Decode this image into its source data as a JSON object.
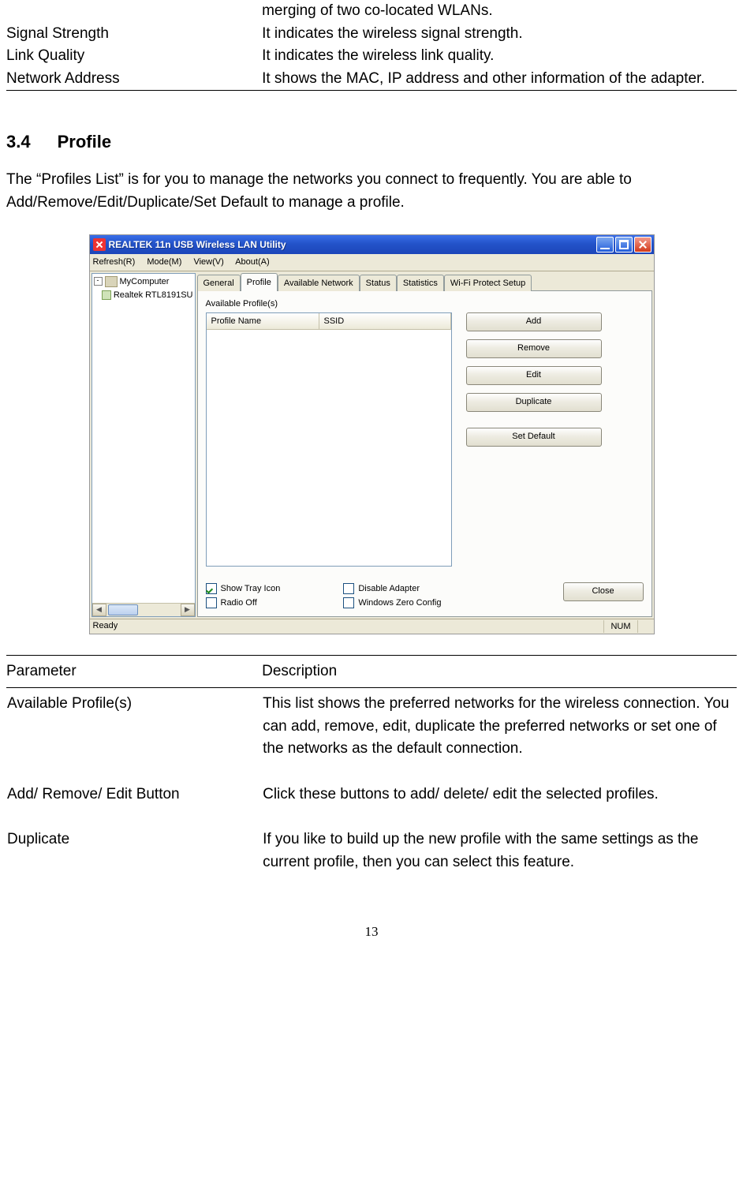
{
  "upper_table": {
    "row0_desc": "merging of two co-located WLANs.",
    "rows": [
      {
        "param": "Signal Strength",
        "desc": "It indicates the wireless signal strength."
      },
      {
        "param": "Link Quality",
        "desc": "It indicates the wireless link quality."
      },
      {
        "param": "Network Address",
        "desc": "It shows the MAC, IP address and other information of the adapter."
      }
    ]
  },
  "section": {
    "number": "3.4",
    "title": "Profile"
  },
  "intro": "The “Profiles List” is for you to manage the networks you connect to frequently. You are able to Add/Remove/Edit/Duplicate/Set Default to manage a profile.",
  "screenshot": {
    "title": "REALTEK 11n USB Wireless LAN Utility",
    "menus": [
      "Refresh(R)",
      "Mode(M)",
      "View(V)",
      "About(A)"
    ],
    "tree": {
      "root": "MyComputer",
      "child": "Realtek RTL8191SU"
    },
    "tabs": [
      "General",
      "Profile",
      "Available Network",
      "Status",
      "Statistics",
      "Wi-Fi Protect Setup"
    ],
    "active_tab": "Profile",
    "available_label": "Available Profile(s)",
    "list_cols": [
      "Profile Name",
      "SSID"
    ],
    "buttons": [
      "Add",
      "Remove",
      "Edit",
      "Duplicate",
      "Set Default"
    ],
    "checks": {
      "show_tray": {
        "label": "Show Tray Icon",
        "checked": true
      },
      "radio_off": {
        "label": "Radio Off",
        "checked": false
      },
      "disable_adapter": {
        "label": "Disable Adapter",
        "checked": false
      },
      "zero_config": {
        "label": "Windows Zero Config",
        "checked": false
      }
    },
    "close": "Close",
    "status": {
      "ready": "Ready",
      "num": "NUM"
    }
  },
  "table2": {
    "head_param": "Parameter",
    "head_desc": "Description",
    "rows": [
      {
        "param": "Available Profile(s)",
        "desc": "This list shows the preferred networks for the wireless connection. You can add, remove, edit, duplicate the preferred networks or set one of the networks as the default connection."
      },
      {
        "param": "Add/ Remove/ Edit Button",
        "desc": "Click these buttons to add/ delete/ edit the selected profiles."
      },
      {
        "param": "Duplicate",
        "desc": "If you like to build up the new profile with the same settings as the current profile, then you can select this feature."
      }
    ]
  },
  "page_number": "13"
}
